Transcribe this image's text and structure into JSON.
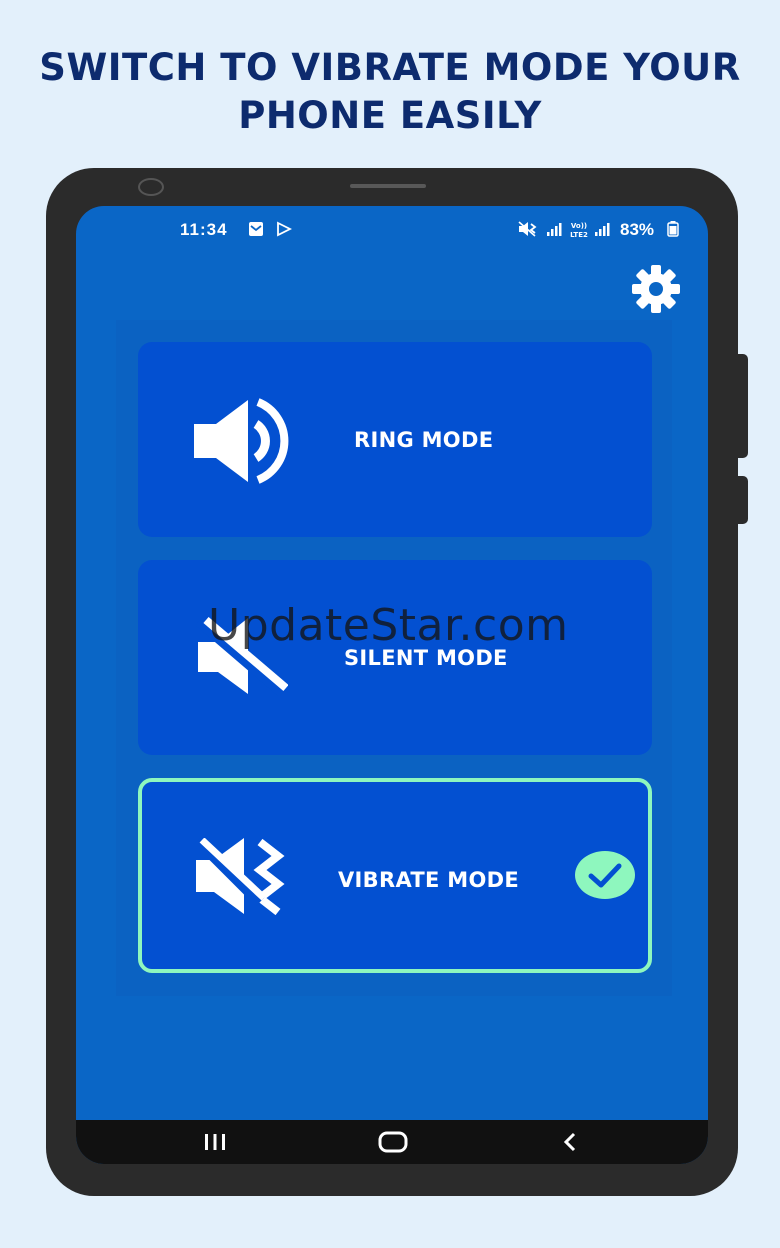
{
  "headline": {
    "line1": "SWITCH TO VIBRATE MODE YOUR",
    "line2": "PHONE EASILY"
  },
  "status_bar": {
    "time": "11:34",
    "battery": "83%",
    "icons_left": [
      "mail-notification-icon",
      "play-store-icon"
    ],
    "icons_right": [
      "vibrate-icon",
      "signal-icon",
      "volte-icon",
      "signal-icon",
      "battery-icon"
    ]
  },
  "modes": [
    {
      "label": "RING MODE",
      "icon": "speaker-volume-icon",
      "selected": false
    },
    {
      "label": "SILENT MODE",
      "icon": "speaker-muted-icon",
      "selected": false
    },
    {
      "label": "VIBRATE MODE",
      "icon": "vibrate-icon",
      "selected": true
    }
  ],
  "settings_icon": "gear-icon",
  "navbar": [
    "recent-apps-icon",
    "home-icon",
    "back-icon"
  ],
  "watermark": "UpdateStar.com",
  "colors": {
    "page_background": "#e3f0fb",
    "headline": "#0d2b6e",
    "screen_background": "#0a66c6",
    "card": "#0350d1",
    "selected_border": "#8ef7be"
  }
}
